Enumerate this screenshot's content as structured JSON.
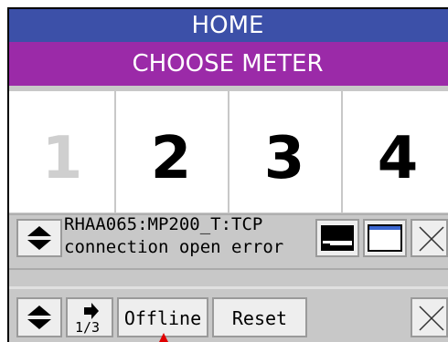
{
  "header": {
    "title": "HOME",
    "subtitle": "CHOOSE METER"
  },
  "meters": [
    {
      "label": "1",
      "enabled": false
    },
    {
      "label": "2",
      "enabled": true
    },
    {
      "label": "3",
      "enabled": true
    },
    {
      "label": "4",
      "enabled": true
    }
  ],
  "status": {
    "line1": "RHAA065:MP200_T:TCP",
    "line2": "connection open error",
    "icons": [
      "scroll-updown-icon",
      "terminal-window-icon",
      "window-icon",
      "close-icon"
    ]
  },
  "toolbar": {
    "page_indicator": "1/3",
    "offline_label": "Offline",
    "reset_label": "Reset",
    "icons": [
      "scroll-updown-icon",
      "next-page-arrow-icon",
      "close-icon"
    ]
  },
  "colors": {
    "header_bg": "#3c50a8",
    "subheader_bg": "#9b2aa8",
    "panel_bg": "#c8c8c8",
    "marker": "#e00000"
  }
}
